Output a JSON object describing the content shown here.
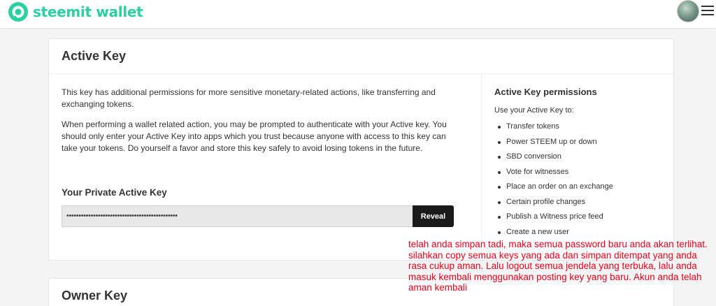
{
  "header": {
    "logo_text": "steemit wallet",
    "brand_color": "#2bcfa2"
  },
  "active_key": {
    "title": "Active Key",
    "description_1": "This key has additional permissions for more sensitive monetary-related actions, like transferring and exchanging tokens.",
    "description_2": "When performing a wallet related action, you may be prompted to authenticate with your Active key. You should only enter your Active Key into apps which you trust because anyone with access to this key can take your tokens. Do yourself a favor and store this key safely to avoid losing tokens in the future.",
    "private_key_label": "Your Private Active Key",
    "private_key_value": "••••••••••••••••••••••••••••••••••••••••••••••",
    "reveal_label": "Reveal",
    "permissions": {
      "title": "Active Key permissions",
      "intro": "Use your Active Key to:",
      "items": [
        "Transfer tokens",
        "Power STEEM up or down",
        "SBD conversion",
        "Vote for witnesses",
        "Place an order on an exchange",
        "Certain profile changes",
        "Publish a Witness price feed",
        "Create a new user"
      ]
    }
  },
  "owner_key": {
    "title": "Owner Key"
  },
  "annotation": {
    "text": "telah anda simpan tadi, maka semua password baru anda akan terlihat. silahkan copy semua keys yang ada dan simpan ditempat yang anda rasa cukup aman. Lalu logout semua jendela yang terbuka, lalu anda masuk kembali menggunakan posting key yang baru. Akun anda telah aman kembali",
    "color": "#e3001b"
  }
}
